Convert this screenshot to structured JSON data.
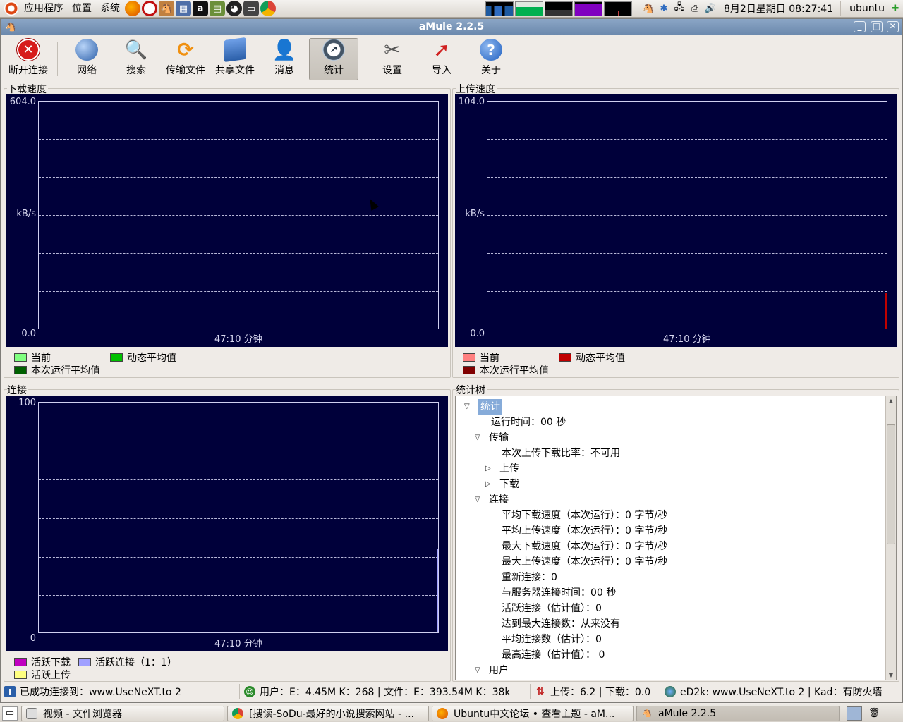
{
  "top_panel": {
    "menus": [
      "应用程序",
      "位置",
      "系统"
    ],
    "launchers": [
      "firefox-icon",
      "opera-icon",
      "amule-icon",
      "screenshot-icon",
      "terminal-a-icon",
      "books-icon",
      "qq-icon",
      "terminal-icon",
      "chrome-icon"
    ],
    "clock": "8月2日星期日 08:27:41",
    "user": "ubuntu"
  },
  "window": {
    "title": "aMule 2.2.5"
  },
  "toolbar": {
    "buttons": [
      {
        "label": "断开连接"
      },
      {
        "label": "网络"
      },
      {
        "label": "搜索"
      },
      {
        "label": "传输文件"
      },
      {
        "label": "共享文件"
      },
      {
        "label": "消息"
      },
      {
        "label": "统计"
      },
      {
        "label": "设置"
      },
      {
        "label": "导入"
      },
      {
        "label": "关于"
      }
    ]
  },
  "download_graph": {
    "title": "下载速度",
    "y_max": "604.0",
    "y_unit": "kB/s",
    "y_min": "0.0",
    "x_label": "47:10 分钟",
    "legend": [
      "当前",
      "动态平均值",
      "本次运行平均值"
    ],
    "colors": [
      "#80ff80",
      "#00c000",
      "#006000"
    ]
  },
  "upload_graph": {
    "title": "上传速度",
    "y_max": "104.0",
    "y_unit": "kB/s",
    "y_min": "0.0",
    "x_label": "47:10 分钟",
    "legend": [
      "当前",
      "动态平均值",
      "本次运行平均值"
    ],
    "colors": [
      "#ff8080",
      "#c00000",
      "#800000"
    ]
  },
  "connections_graph": {
    "title": "连接",
    "y_max": "100",
    "y_min": "0",
    "x_label": "47:10 分钟",
    "legend": [
      "活跃下载",
      "活跃连接（1：1）",
      "活跃上传"
    ],
    "colors": [
      "#c000c0",
      "#a0a0ff",
      "#ffff80"
    ]
  },
  "stats_tree": {
    "title": "统计树",
    "rows": [
      {
        "text": "统计",
        "toggle": "▽"
      },
      {
        "text": "运行时间：00 秒",
        "toggle": ""
      },
      {
        "text": "传输",
        "toggle": "▽"
      },
      {
        "text": "本次上传下载比率：不可用",
        "toggle": ""
      },
      {
        "text": "上传",
        "toggle": "▷"
      },
      {
        "text": "下载",
        "toggle": "▷"
      },
      {
        "text": "连接",
        "toggle": "▽"
      },
      {
        "text": "平均下载速度（本次运行）：0 字节/秒",
        "toggle": ""
      },
      {
        "text": "平均上传速度（本次运行）：0 字节/秒",
        "toggle": ""
      },
      {
        "text": "最大下载速度（本次运行）：0 字节/秒",
        "toggle": ""
      },
      {
        "text": "最大上传速度（本次运行）：0 字节/秒",
        "toggle": ""
      },
      {
        "text": "重新连接：0",
        "toggle": ""
      },
      {
        "text": "与服务器连接时间：00 秒",
        "toggle": ""
      },
      {
        "text": "活跃连接（估计值）：0",
        "toggle": ""
      },
      {
        "text": "达到最大连接数：从来没有",
        "toggle": ""
      },
      {
        "text": "平均连接数（估计）：0",
        "toggle": ""
      },
      {
        "text": "最高连接（估计值）： 0",
        "toggle": ""
      },
      {
        "text": "用户",
        "toggle": "▽"
      }
    ]
  },
  "status_bar": {
    "connection": "已成功连接到：www.UseNeXT.to 2",
    "users_files": "用户：E：4.45M K：268 | 文件：E：393.54M K：38k",
    "speed": "上传：6.2 | 下载：0.0",
    "network": "eD2k: www.UseNeXT.to 2 | Kad：有防火墙"
  },
  "taskbar": {
    "tasks": [
      {
        "label": "视频 - 文件浏览器"
      },
      {
        "label": "[搜读-SoDu-最好的小说搜索网站 - ..."
      },
      {
        "label": "Ubuntu中文论坛 • 查看主题 - aM..."
      },
      {
        "label": "aMule 2.2.5"
      }
    ]
  }
}
